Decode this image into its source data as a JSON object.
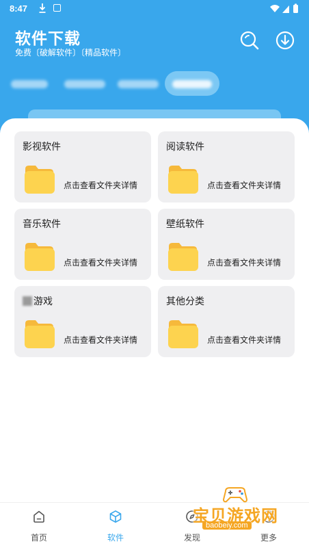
{
  "status_bar": {
    "time": "8:47"
  },
  "header": {
    "title": "软件下载",
    "subtitle": "免费〔破解软件〕〔精品软件〕",
    "search_icon": "search-icon",
    "download_icon": "download-icon"
  },
  "tabs": [
    {
      "label": "",
      "active": false
    },
    {
      "label": "",
      "active": false
    },
    {
      "label": "",
      "active": false
    },
    {
      "label": "",
      "active": true
    }
  ],
  "categories": [
    {
      "title": "影视软件",
      "link": "点击查看文件夹详情"
    },
    {
      "title": "阅读软件",
      "link": "点击查看文件夹详情"
    },
    {
      "title": "音乐软件",
      "link": "点击查看文件夹详情"
    },
    {
      "title": "壁纸软件",
      "link": "点击查看文件夹详情"
    },
    {
      "title": "游戏",
      "link": "点击查看文件夹详情"
    },
    {
      "title": "其他分类",
      "link": "点击查看文件夹详情"
    }
  ],
  "bottom_nav": [
    {
      "label": "首页",
      "icon": "home-icon",
      "active": false
    },
    {
      "label": "软件",
      "icon": "cube-icon",
      "active": true
    },
    {
      "label": "发现",
      "icon": "compass-icon",
      "active": false
    },
    {
      "label": "更多",
      "icon": "more-icon",
      "active": false
    }
  ],
  "watermark": {
    "text": "宝贝游戏网",
    "url": "baobeiy.com"
  },
  "colors": {
    "primary": "#39a7ec",
    "folder": "#fdd34f",
    "card_bg": "#efeff1"
  }
}
